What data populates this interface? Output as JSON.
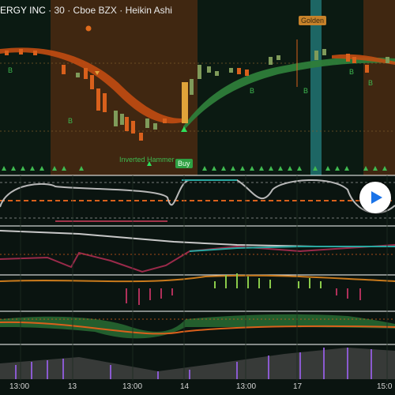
{
  "header": {
    "symbol": "ERGY INC",
    "interval": "30",
    "exchange": "Cboe BZX",
    "chart_style": "Heikin Ashi",
    "separator": "·"
  },
  "signals": {
    "golden_label": "Golden",
    "buy_label": "Buy",
    "pattern_label": "Inverted Hammer",
    "b_label": "B"
  },
  "controls": {
    "play_button": "play-icon"
  },
  "x_axis": {
    "ticks": [
      "13:00",
      "13",
      "13:00",
      "14",
      "13:00",
      "17",
      "15:0"
    ]
  },
  "colors": {
    "bull": "#3fb950",
    "bear": "#d9601c",
    "session_bg": "#4a2a12",
    "teal_band": "#1f6f6e",
    "oscillator": "#b8b8b8"
  }
}
